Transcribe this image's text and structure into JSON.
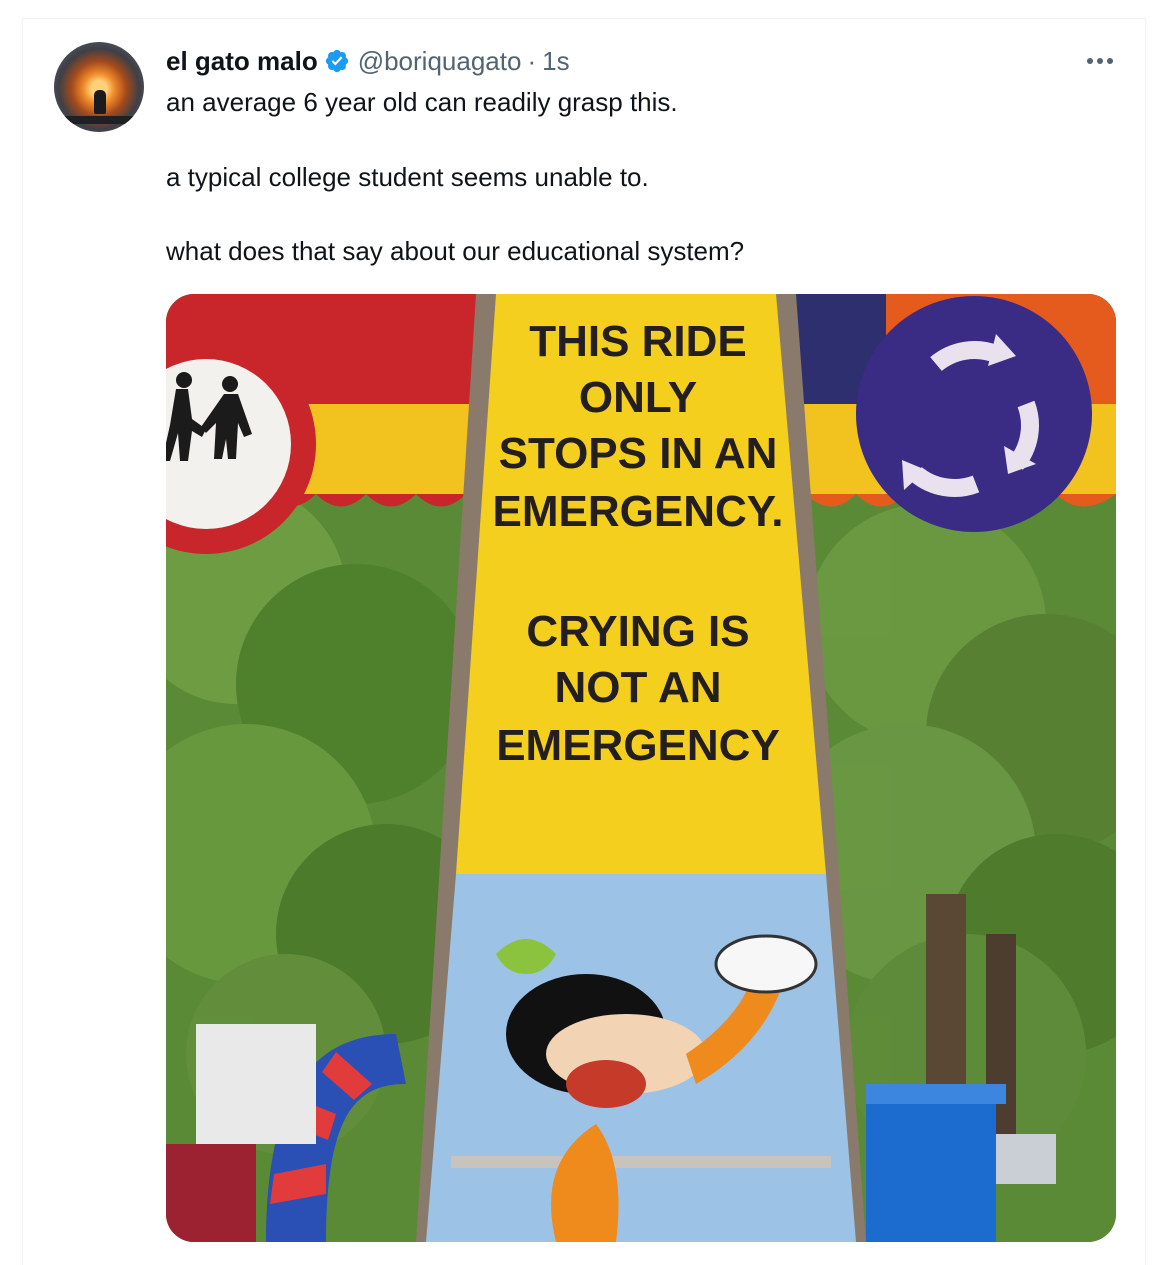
{
  "tweet": {
    "author_name": "el gato malo",
    "handle": "@boriquagato",
    "separator": "·",
    "time": "1s",
    "lines": [
      "an average 6 year old can readily grasp this.",
      "a typical college student seems unable to.",
      "what does that say about our educational system?"
    ]
  },
  "media": {
    "sign_top": [
      "THIS RIDE",
      "ONLY",
      "STOPS IN AN",
      "EMERGENCY."
    ],
    "sign_bottom": [
      "CRYING IS",
      "NOT AN",
      "EMERGENCY"
    ]
  },
  "icons": {
    "verified": "verified-badge-icon",
    "more": "more-options-icon"
  },
  "colors": {
    "verified_blue": "#1d9bf0",
    "secondary_text": "#536471",
    "sign_yellow": "#f5cf1d"
  }
}
